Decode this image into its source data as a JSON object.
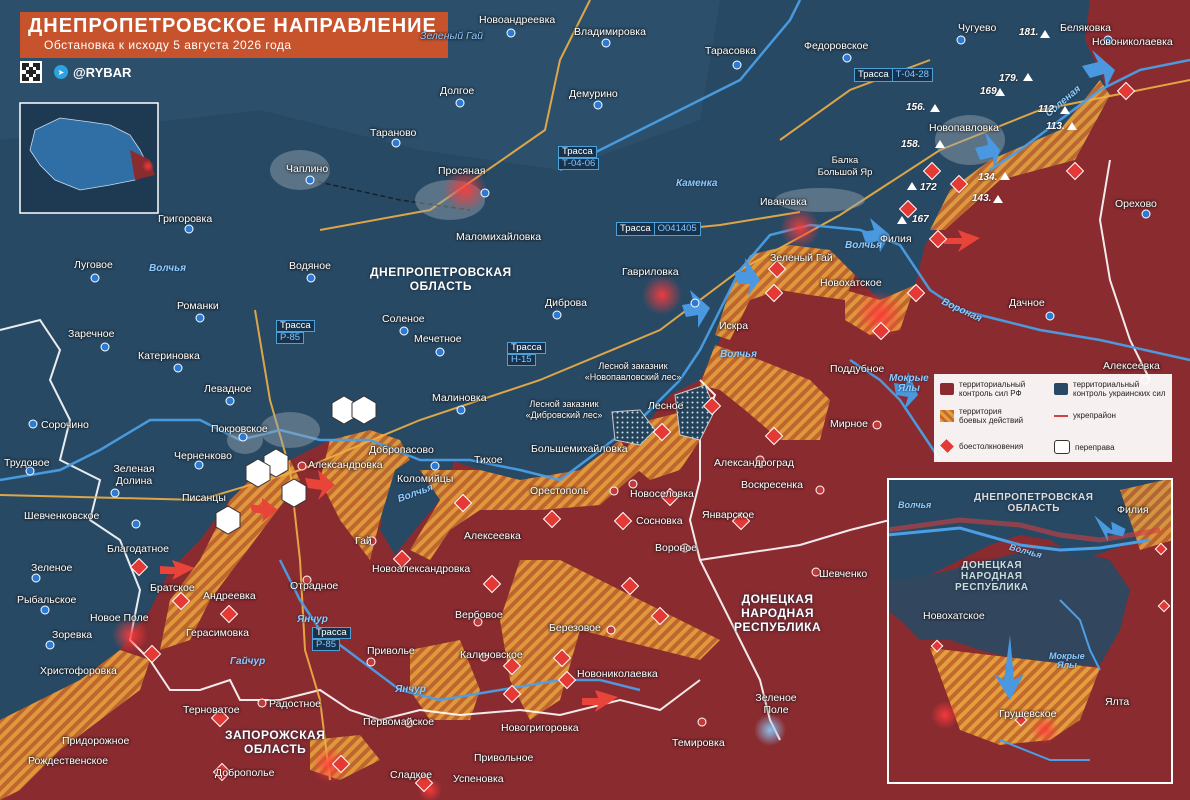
{
  "header": {
    "title": "ДНЕПРОПЕТРОВСКОЕ НАПРАВЛЕНИЕ",
    "subtitle": "Обстановка к исходу 5 августа 2026 года",
    "handle": "@RYBAR"
  },
  "colors": {
    "ru_control": "#8c2c30",
    "ua_control": "#2b4b67",
    "contested": "#e39a3c",
    "accent": "#c7532d",
    "river": "#4a9fe6"
  },
  "oblasts": {
    "dnepr": "ДНЕПРОПЕТРОВСКАЯ\nОБЛАСТЬ",
    "dnr": "ДОНЕЦКАЯ\nНАРОДНАЯ\nРЕСПУБЛИКА",
    "zap": "ЗАПОРОЖСКАЯ\nОБЛАСТЬ"
  },
  "settlements": {
    "novoandreevka": "Новоандреевка",
    "vladimirovka": "Владимировка",
    "tarasovka": "Тарасовка",
    "fedorovskoe": "Федоровское",
    "chuguevo": "Чугуево",
    "belyakovka": "Беляковка",
    "novonikolaevka_ne": "Новониколаевка",
    "zeleny_gai_n": "Зеленый Гай",
    "dolgoe": "Долгое",
    "demurino": "Демурино",
    "novopavlovka": "Новопавловка",
    "taranovo": "Тараново",
    "chaplino": "Чаплино",
    "prosyanaya": "Просяная",
    "grigorovka": "Григоровка",
    "malomikhailovka": "Маломихайловка",
    "ivanovka": "Ивановка",
    "balka": "Балка\nБольшой Яр",
    "orekhovo": "Орехово",
    "filiya": "Филия",
    "lugovoe": "Луговое",
    "vodyanoe": "Водяное",
    "gavrilovka": "Гавриловка",
    "zeleny_gai": "Зеленый Гай",
    "novokhatskoe": "Новохатское",
    "dachnoe": "Дачное",
    "romanki": "Романки",
    "dibrova": "Диброва",
    "iskra": "Искра",
    "zarechnoe": "Заречное",
    "solenoe": "Соленое",
    "mechetnoe": "Мечетное",
    "alekseevka_e": "Алексеевка",
    "katerinovka": "Катериновка",
    "poddubnoe": "Поддубное",
    "levadnoe": "Левадное",
    "malinovka": "Малиновка",
    "lesnoe": "Лесное",
    "mirnoe": "Мирное",
    "sorochino": "Сорочино",
    "pokrovskoe": "Покровское",
    "dobropasovo": "Добропасово",
    "bolshemikhailovka": "Большемихайловка",
    "trudovoe": "Трудовое",
    "chernenkovo": "Черненково",
    "aleksandrovka": "Александровка",
    "tikhoe": "Тихое",
    "aleksandrograd": "Александроград",
    "zelenaya_dolina": "Зеленая\nДолина",
    "kolomiytsy": "Коломийцы",
    "voskresenka": "Воскресенка",
    "pisantsy": "Писанцы",
    "orestopol": "Орестополь",
    "novoselovka": "Новоселовка",
    "shevchenkovskoe": "Шевченковское",
    "sosnovka": "Сосновка",
    "yanvarskoe": "Январское",
    "gai": "Гай",
    "alekseevka_s": "Алексеевка",
    "voronoe": "Вороное",
    "shevchenko": "Шевченко",
    "blagodatnoe": "Благодатное",
    "zelenoe": "Зеленое",
    "bratskoe": "Братское",
    "otradnoe": "Отрадное",
    "novoaleksandrovka": "Новоалександровка",
    "andreevka": "Андреевка",
    "rybalskoe": "Рыбальское",
    "novoe_pole": "Новое Поле",
    "verbovoe": "Вербовое",
    "berezovoe": "Березовое",
    "zorevka": "Зоревка",
    "gerasimovka": "Герасимовка",
    "khristoforovka": "Христофоровка",
    "privolye": "Приволье",
    "kalinovskoe": "Калиновское",
    "novonikolaevka_s": "Новониколаевка",
    "zelenoe_pole": "Зеленое\nПоле",
    "ternovatoe": "Терноватое",
    "radostnoe": "Радостное",
    "pervomayskoe": "Первомайское",
    "novogrigorovka": "Новогригоровка",
    "pridorozhnoe": "Придорожное",
    "temirovka": "Темировка",
    "rozhdestvenskoe": "Рождественское",
    "privolnoe": "Привольное",
    "dobropolye": "Доброполье",
    "sladkoe": "Сладкое",
    "uspenovka": "Успеновка",
    "lesnoy1": "Лесной заказник\n«Новопавловский лес»",
    "lesnoy2": "Лесной заказник\n«Дибровский лес»"
  },
  "rivers": {
    "volchya1": "Волчья",
    "volchya2": "Волчья",
    "volchya3": "Волчья",
    "volchya4": "Волчья",
    "kamenka": "Каменка",
    "solenaya": "Соленая",
    "mokrye_yaly": "Мокрые\nЯлы",
    "yanchur1": "Янчур",
    "yanchur2": "Янчур",
    "gaichur": "Гайчур",
    "vorona": "Вороная"
  },
  "roads": {
    "t0428_label": "Трасса",
    "t0428": "Т-04-28",
    "t0406_label": "Трасса",
    "t0406": "Т-04-06",
    "o041405_label": "Трасса",
    "o041405": "О041405",
    "r85a_label": "Трасса",
    "r85a": "Р-85",
    "h15_label": "Трасса",
    "h15": "Н-15",
    "r85b_label": "Трасса",
    "r85b": "Р-85"
  },
  "heights": {
    "h181": "181.",
    "h179": "179.",
    "h169": "169.",
    "h156": "156.",
    "h112": "112.",
    "h158": "158.",
    "h113": "113.",
    "h172": "172",
    "h134": "134.",
    "h143": "143.",
    "h167": "167"
  },
  "legend": {
    "ru": "территориальный\nконтроль сил РФ",
    "ua": "территориальный\nконтроль украинских сил",
    "contested": "территория\nбоевых действий",
    "fortline": "укрепрайон",
    "clashes": "боестолкновения",
    "crossing": "переправа"
  },
  "inset": {
    "dnepr": "ДНЕПРОПЕТРОВСКАЯ\nОБЛАСТЬ",
    "dnr": "ДОНЕЦКАЯ\nНАРОДНАЯ\nРЕСПУБЛИКА",
    "filiya": "Филия",
    "novokhatskoe": "Новохатское",
    "grushevskoe": "Грушевское",
    "yalta": "Ялта",
    "volchya": "Волчья",
    "volchya2": "Волчья",
    "mokrye_yaly": "Мокрые\nЯлы"
  }
}
